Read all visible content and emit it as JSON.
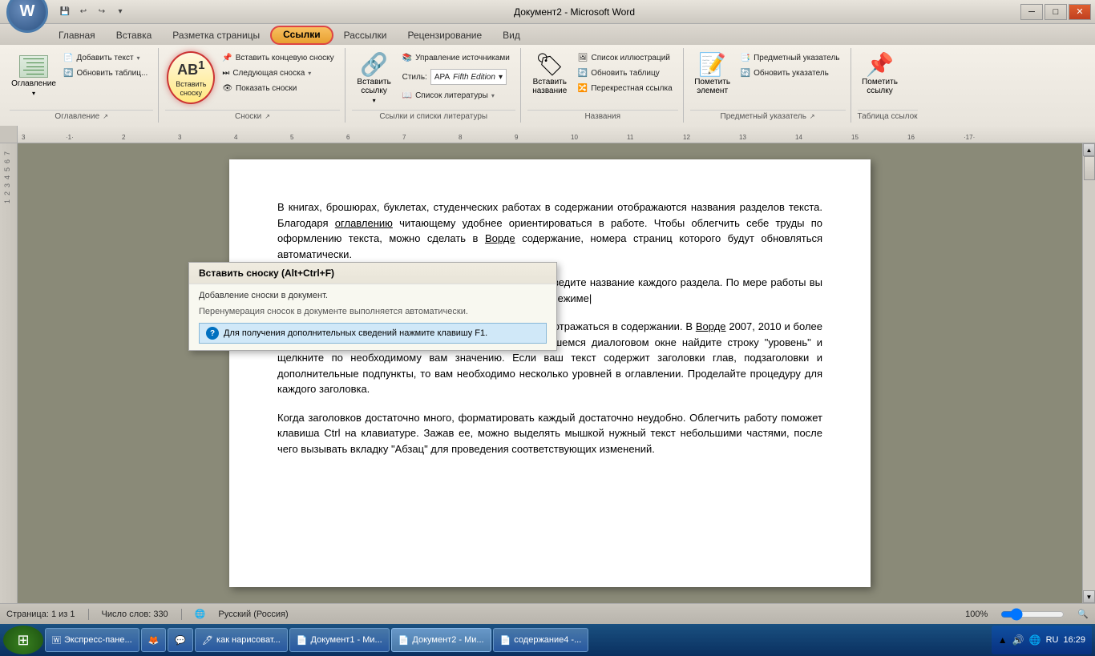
{
  "titleBar": {
    "title": "Документ2 - Microsoft Word",
    "quickAccess": [
      "save",
      "undo",
      "redo",
      "customize"
    ],
    "controls": [
      "minimize",
      "maximize",
      "close"
    ]
  },
  "ribbon": {
    "tabs": [
      {
        "id": "home",
        "label": "Главная"
      },
      {
        "id": "insert",
        "label": "Вставка"
      },
      {
        "id": "layout",
        "label": "Разметка страницы"
      },
      {
        "id": "references",
        "label": "Ссылки",
        "active": true,
        "highlighted": true
      },
      {
        "id": "mailings",
        "label": "Рассылки"
      },
      {
        "id": "review",
        "label": "Рецензирование"
      },
      {
        "id": "view",
        "label": "Вид"
      }
    ],
    "groups": {
      "toc": {
        "label": "Оглавление",
        "buttons": [
          {
            "id": "toc",
            "label": "Оглавление",
            "icon": "📋",
            "hasArrow": true
          }
        ],
        "small_buttons": [
          {
            "id": "add-text",
            "label": "Добавить текст",
            "hasArrow": true
          },
          {
            "id": "update-table",
            "label": "Обновить таблиц..."
          }
        ]
      },
      "footnotes": {
        "label": "Сноски",
        "buttons": [
          {
            "id": "insert-footnote",
            "label": "Вставить\nсноску",
            "icon": "AB¹",
            "highlighted": true
          },
          {
            "id": "insert-endnote",
            "label": "Вставить концевую сноску"
          },
          {
            "id": "next-footnote",
            "label": "Следующая сноска",
            "hasArrow": true
          },
          {
            "id": "show-notes",
            "label": "Показать сноски"
          }
        ]
      },
      "citations": {
        "label": "Ссылки и списки литературы",
        "buttons": [
          {
            "id": "insert-citation",
            "label": "Вставить\nссылку",
            "hasArrow": true
          },
          {
            "id": "manage-sources",
            "label": "Управление источниками"
          },
          {
            "id": "style",
            "label": "Стиль:",
            "value": "APA Fifth Edition",
            "hasArrow": true
          },
          {
            "id": "bibliography",
            "label": "Список литературы",
            "hasArrow": true
          }
        ]
      },
      "captions": {
        "label": "Названия",
        "buttons": [
          {
            "id": "insert-caption",
            "label": "Вставить\nназвание"
          },
          {
            "id": "insert-table-figures",
            "label": "Список иллюстраций"
          },
          {
            "id": "update-table2",
            "label": "Обновить таблицу"
          },
          {
            "id": "cross-reference",
            "label": "Перекрестная ссылка"
          }
        ]
      },
      "index": {
        "label": "Предметный указатель",
        "buttons": [
          {
            "id": "mark-entry",
            "label": "Пометить\nэлемент"
          },
          {
            "id": "insert-index",
            "label": "Предметный указатель"
          },
          {
            "id": "update-index",
            "label": "Обновить указатель"
          }
        ]
      },
      "table-of-authorities": {
        "label": "Таблица ссылок",
        "buttons": [
          {
            "id": "mark-citation",
            "label": "Пометить\nссылку"
          }
        ]
      }
    }
  },
  "tooltip": {
    "title": "Вставить сноску (Alt+Ctrl+F)",
    "description": "Добавление сноски в документ.",
    "note": "Перенумерация сносок в документе выполняется автоматически.",
    "helpText": "Для получения дополнительных сведений нажмите клавишу F1."
  },
  "document": {
    "paragraphs": [
      "В книгах, брошюрах, буклетах, студенческих работах в содержании отображаются названия разделов текста. Благодаря оглавлению читающему удобнее ориентироваться в работе. Чтобы облегчить себе труды по оформлению текста, можно сделать в Ворде содержание, номера страниц которого будут обновляться автоматически.",
      "Чтобы сделать в Ворде содержание, наберите текст и введите название каждого раздела. По мере работы вы сможете обновлять ваше оглавление в автоматическом режиме.",
      "Выделите мышкой названия разделов, которые должны отражаться в содержании. В Ворде 2007, 2010 и более поздних версиях выберите вкладку \"Абзац\". В открывшемся диалоговом окне найдите строку \"уровень\" и щелкните по необходимому вам значению. Если ваш текст содержит заголовки глав, подзаголовки и дополнительные подпункты, то вам необходимо несколько уровней в оглавлении. Проделайте процедуру для каждого заголовка.",
      "Когда заголовков достаточно много, форматировать каждый достаточно неудобно. Облегчить работу поможет клавиша Ctrl на клавиатуре. Зажав ее, можно выделять мышкой нужный текст небольшими частями, после чего вызывать вкладку \"Абзац\" для проведения соответствующих изменений."
    ],
    "underlinedWords": [
      "оглавлению",
      "Ворде",
      "Ворде",
      "Ворде"
    ]
  },
  "statusBar": {
    "page": "Страница: 1 из 1",
    "words": "Число слов: 330",
    "language": "Русский (Россия)",
    "zoom": "100%"
  },
  "taskbar": {
    "startLabel": "⊞",
    "items": [
      {
        "id": "express",
        "label": "Экспресс-пане...",
        "active": false
      },
      {
        "id": "firefox",
        "label": "🦊",
        "active": false,
        "iconOnly": true
      },
      {
        "id": "chat",
        "label": "💬",
        "active": false,
        "iconOnly": true
      },
      {
        "id": "draw",
        "label": "как нарисоват...",
        "active": false
      },
      {
        "id": "doc1",
        "label": "Документ1 - Ми...",
        "active": false
      },
      {
        "id": "doc2",
        "label": "Документ2 - Ми...",
        "active": true
      },
      {
        "id": "content",
        "label": "содержание4 -...",
        "active": false
      }
    ],
    "sysTray": {
      "lang": "RU",
      "time": "16:29",
      "icons": [
        "🔊",
        "🌐",
        "📋"
      ]
    }
  }
}
